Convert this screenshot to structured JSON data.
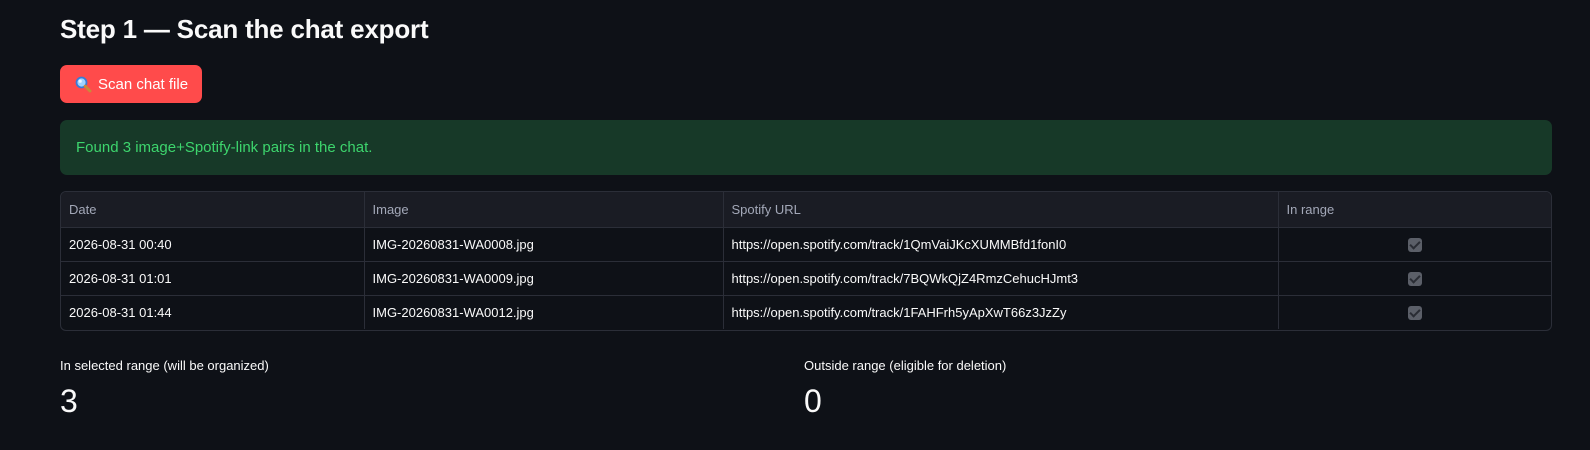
{
  "heading": "Step 1 — Scan the chat export",
  "scan_button": {
    "label": "Scan chat file",
    "icon": "magnifier-icon"
  },
  "alert": {
    "text": "Found 3 image+Spotify-link pairs in the chat.",
    "color": "#3dd56d"
  },
  "table": {
    "columns": [
      "Date",
      "Image",
      "Spotify URL",
      "In range"
    ],
    "rows": [
      {
        "date": "2026-08-31 00:40",
        "image": "IMG-20260831-WA0008.jpg",
        "url": "https://open.spotify.com/track/1QmVaiJKcXUMMBfd1fonI0",
        "in_range": true
      },
      {
        "date": "2026-08-31 01:01",
        "image": "IMG-20260831-WA0009.jpg",
        "url": "https://open.spotify.com/track/7BQWkQjZ4RmzCehucHJmt3",
        "in_range": true
      },
      {
        "date": "2026-08-31 01:44",
        "image": "IMG-20260831-WA0012.jpg",
        "url": "https://open.spotify.com/track/1FAHFrh5yApXwT66z3JzZy",
        "in_range": true
      }
    ]
  },
  "metrics": [
    {
      "label": "In selected range (will be organized)",
      "value": "3"
    },
    {
      "label": "Outside range (eligible for deletion)",
      "value": "0"
    }
  ],
  "colors": {
    "background": "#0e1117",
    "primary_button": "#ff4b4b",
    "success_bg": "#173928"
  }
}
